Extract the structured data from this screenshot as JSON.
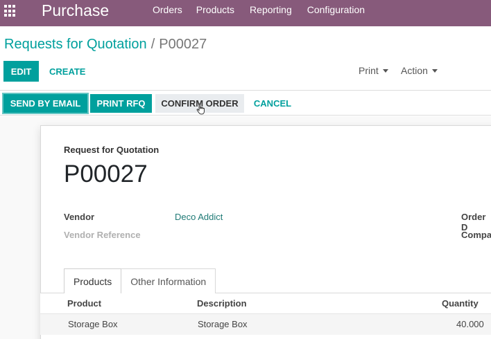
{
  "navbar": {
    "app_name": "Purchase",
    "menu": [
      "Orders",
      "Products",
      "Reporting",
      "Configuration"
    ],
    "apps_icon": "apps-grid-icon",
    "color": "#875a7b"
  },
  "breadcrumb": {
    "parent": "Requests for Quotation",
    "separator": "/",
    "current": "P00027"
  },
  "control_panel": {
    "edit": "EDIT",
    "create": "CREATE",
    "print": "Print",
    "action": "Action"
  },
  "statusbar": {
    "send_by_email": "SEND BY EMAIL",
    "print_rfq": "PRINT RFQ",
    "confirm_order": "CONFIRM ORDER",
    "cancel": "CANCEL"
  },
  "form": {
    "doc_kind": "Request for Quotation",
    "doc_name": "P00027",
    "vendor_label": "Vendor",
    "vendor_value": "Deco Addict",
    "vendor_ref_label": "Vendor Reference",
    "order_date_label": "Order D",
    "company_label": "Compa"
  },
  "tabs": [
    "Products",
    "Other Information"
  ],
  "table": {
    "headers": {
      "product": "Product",
      "description": "Description",
      "quantity": "Quantity"
    },
    "rows": [
      {
        "product": "Storage Box",
        "description": "Storage Box",
        "quantity": "40.000"
      }
    ]
  },
  "colors": {
    "accent": "#00a09d",
    "brand": "#875a7b"
  }
}
